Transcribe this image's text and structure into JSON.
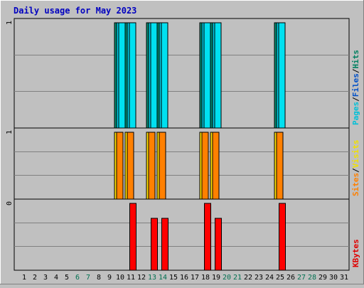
{
  "chart_data": {
    "type": "bar",
    "title": "Daily usage for May 2023",
    "days": [
      "1",
      "2",
      "3",
      "4",
      "5",
      "6",
      "7",
      "8",
      "9",
      "10",
      "11",
      "12",
      "13",
      "14",
      "15",
      "16",
      "17",
      "18",
      "19",
      "20",
      "21",
      "22",
      "23",
      "24",
      "25",
      "26",
      "27",
      "28",
      "29",
      "30",
      "31"
    ],
    "weekend_days": [
      "6",
      "7",
      "13",
      "14",
      "20",
      "21",
      "27",
      "28"
    ],
    "panels": [
      {
        "id": "pages-files-hits",
        "ymax_label": "1",
        "ymax": 1,
        "side_labels": [
          {
            "text": "Pages",
            "color": "#00c0d8"
          },
          {
            "text": "/",
            "color": "#000000"
          },
          {
            "text": "Files",
            "color": "#0050c8"
          },
          {
            "text": "/",
            "color": "#000000"
          },
          {
            "text": "Hits",
            "color": "#008060"
          }
        ],
        "series": [
          {
            "name": "Hits",
            "color": "#008c70",
            "values": [
              0,
              0,
              0,
              0,
              0,
              0,
              0,
              0,
              0,
              1,
              1,
              0,
              1,
              1,
              0,
              0,
              0,
              1,
              1,
              0,
              0,
              0,
              0,
              0,
              1,
              0,
              0,
              0,
              0,
              0,
              0
            ]
          },
          {
            "name": "Files",
            "color": "#00c8e0",
            "values": [
              0,
              0,
              0,
              0,
              0,
              0,
              0,
              0,
              0,
              1,
              1,
              0,
              1,
              1,
              0,
              0,
              0,
              1,
              1,
              0,
              0,
              0,
              0,
              0,
              1,
              0,
              0,
              0,
              0,
              0,
              0
            ]
          },
          {
            "name": "Pages",
            "color": "#00e0f0",
            "values": [
              0,
              0,
              0,
              0,
              0,
              0,
              0,
              0,
              0,
              1,
              1,
              0,
              1,
              1,
              0,
              0,
              0,
              1,
              1,
              0,
              0,
              0,
              0,
              0,
              1,
              0,
              0,
              0,
              0,
              0,
              0
            ]
          }
        ]
      },
      {
        "id": "visits-sites",
        "ymax_label": "1",
        "ymax": 1,
        "side_labels": [
          {
            "text": "Sites",
            "color": "#ff8000"
          },
          {
            "text": "/",
            "color": "#000000"
          },
          {
            "text": "Visits",
            "color": "#f0e000"
          }
        ],
        "series": [
          {
            "name": "Visits",
            "color": "#ffe000",
            "values": [
              0,
              0,
              0,
              0,
              0,
              0,
              0,
              0,
              0,
              1,
              1,
              0,
              1,
              1,
              0,
              0,
              0,
              1,
              1,
              0,
              0,
              0,
              0,
              0,
              1,
              0,
              0,
              0,
              0,
              0,
              0
            ]
          },
          {
            "name": "Sites",
            "color": "#ff8000",
            "values": [
              0,
              0,
              0,
              0,
              0,
              0,
              0,
              0,
              0,
              1,
              1,
              0,
              1,
              1,
              0,
              0,
              0,
              1,
              1,
              0,
              0,
              0,
              0,
              0,
              1,
              0,
              0,
              0,
              0,
              0,
              0
            ]
          }
        ]
      },
      {
        "id": "kbytes",
        "ymax_label": "0",
        "ymax": 1,
        "side_labels": [
          {
            "text": "KBytes",
            "color": "#e00000"
          }
        ],
        "series": [
          {
            "name": "KBytes",
            "color": "#ff0000",
            "values": [
              0,
              0,
              0,
              0,
              0,
              0,
              0,
              0,
              0,
              0,
              1,
              0,
              0.78,
              0.78,
              0,
              0,
              0,
              1,
              0.78,
              0,
              0,
              0,
              0,
              0,
              1,
              0,
              0,
              0,
              0,
              0,
              0
            ]
          }
        ]
      }
    ]
  }
}
